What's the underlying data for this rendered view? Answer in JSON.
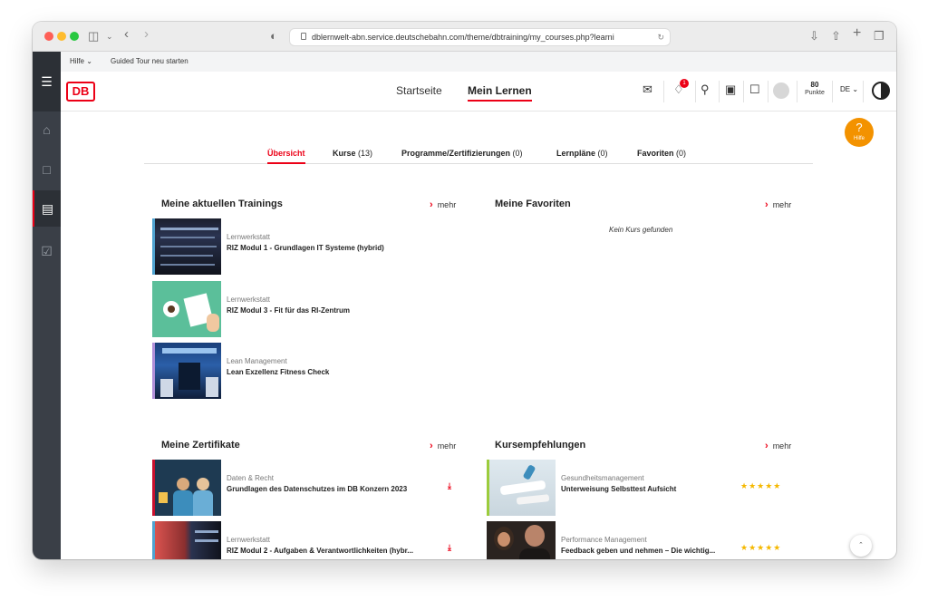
{
  "browser": {
    "url": "dblernwelt-abn.service.deutschebahn.com/theme/dbtraining/my_courses.php?learni"
  },
  "helpbar": {
    "help_label": "Hilfe",
    "tour_label": "Guided Tour neu starten"
  },
  "header": {
    "logo_text": "DB",
    "nav_start": "Startseite",
    "nav_mylearning": "Mein Lernen",
    "notif_count": "1",
    "points_value": "80",
    "points_label": "Punkte",
    "lang": "DE"
  },
  "help_fab": {
    "label": "Hilfe"
  },
  "tabs": [
    {
      "label": "Übersicht",
      "count": ""
    },
    {
      "label": "Kurse",
      "count": "(13)"
    },
    {
      "label": "Programme/Zertifizierungen",
      "count": "(0)"
    },
    {
      "label": "Lernpläne",
      "count": "(0)"
    },
    {
      "label": "Favoriten",
      "count": "(0)"
    }
  ],
  "mehr_label": "mehr",
  "trainings": {
    "title": "Meine aktuellen Trainings",
    "items": [
      {
        "category": "Lernwerkstatt",
        "title": "RIZ Modul 1 - Grundlagen IT Systeme (hybrid)"
      },
      {
        "category": "Lernwerkstatt",
        "title": "RIZ Modul 3 - Fit für das RI-Zentrum"
      },
      {
        "category": "Lean Management",
        "title": "Lean Exzellenz Fitness Check"
      }
    ]
  },
  "favorites": {
    "title": "Meine Favoriten",
    "empty": "Kein Kurs gefunden"
  },
  "certificates": {
    "title": "Meine Zertifikate",
    "items": [
      {
        "category": "Daten & Recht",
        "title": "Grundlagen des Datenschutzes im DB Konzern 2023"
      },
      {
        "category": "Lernwerkstatt",
        "title": "RIZ Modul 2 - Aufgaben & Verantwortlichkeiten (hybr..."
      }
    ]
  },
  "recommendations": {
    "title": "Kursempfehlungen",
    "items": [
      {
        "category": "Gesundheitsmanagement",
        "title": "Unterweisung Selbsttest Aufsicht",
        "rating": 5
      },
      {
        "category": "Performance Management",
        "title": "Feedback geben und nehmen – Die wichtig...",
        "rating": 5
      }
    ]
  },
  "colors": {
    "brand": "#ec0016",
    "help": "#f39200",
    "rail": "#3a3f47"
  }
}
